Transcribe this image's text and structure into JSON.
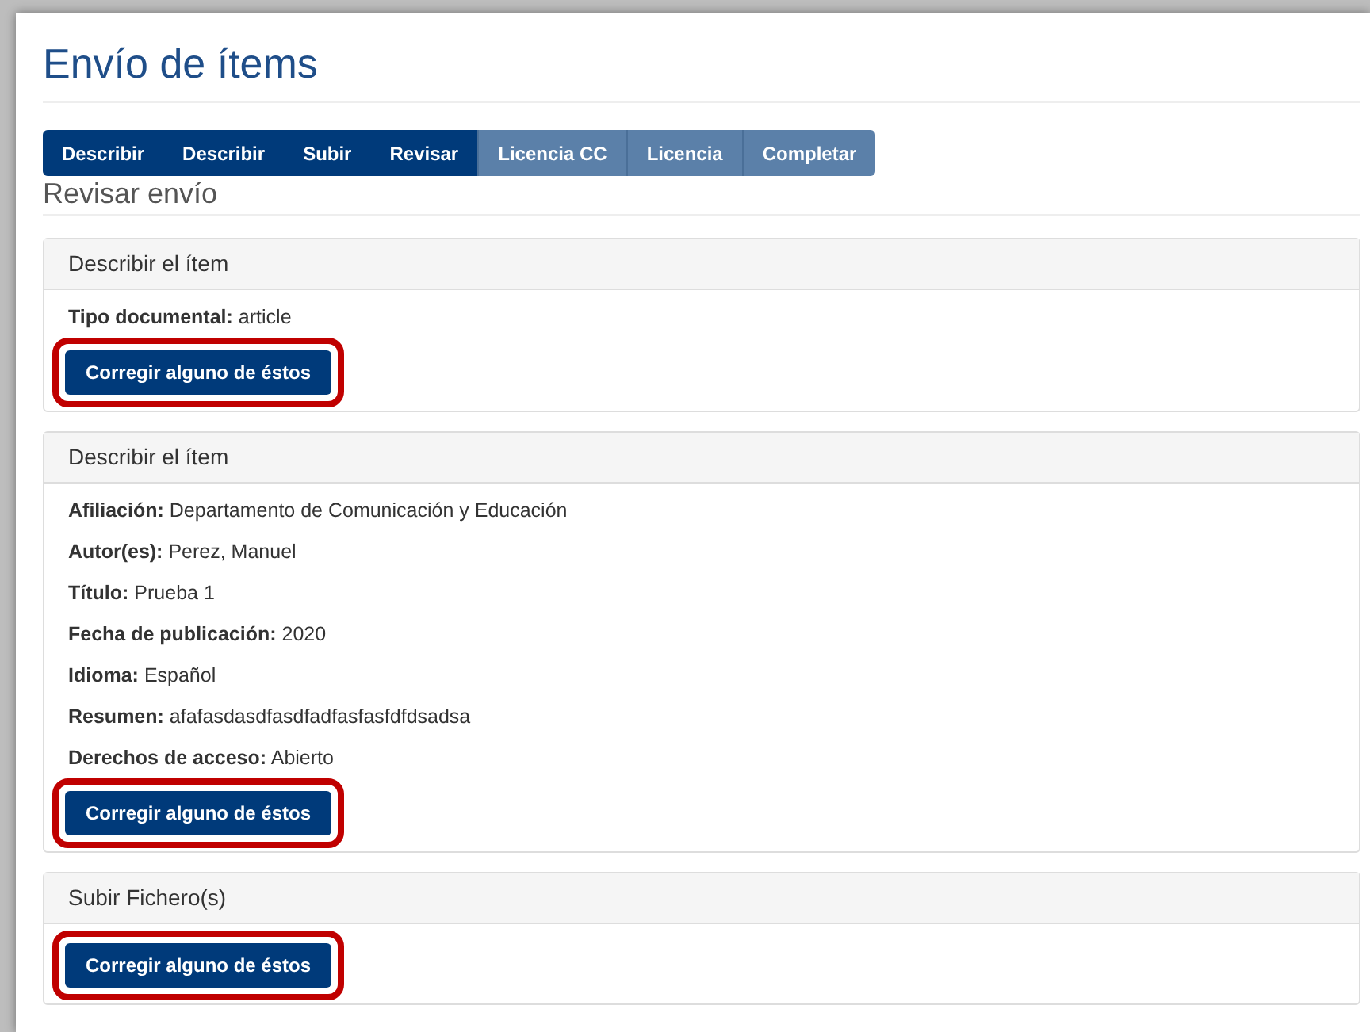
{
  "title": "Envío de ítems",
  "steps": [
    {
      "label": "Describir",
      "reached": true
    },
    {
      "label": "Describir",
      "reached": true
    },
    {
      "label": "Subir",
      "reached": true
    },
    {
      "label": "Revisar",
      "reached": true
    },
    {
      "label": "Licencia CC",
      "reached": false
    },
    {
      "label": "Licencia",
      "reached": false
    },
    {
      "label": "Completar",
      "reached": false
    }
  ],
  "subtitle": "Revisar envío",
  "sections": [
    {
      "heading": "Describir el ítem",
      "fields": [
        {
          "label": "Tipo documental:",
          "value": "article"
        }
      ],
      "button": "Corregir alguno de éstos",
      "highlighted": true
    },
    {
      "heading": "Describir el ítem",
      "fields": [
        {
          "label": "Afiliación:",
          "value": "Departamento de Comunicación y Educación"
        },
        {
          "label": "Autor(es):",
          "value": "Perez, Manuel"
        },
        {
          "label": "Título:",
          "value": "Prueba 1"
        },
        {
          "label": "Fecha de publicación:",
          "value": "2020"
        },
        {
          "label": "Idioma:",
          "value": "Español"
        },
        {
          "label": "Resumen:",
          "value": "afafasdasdfasdfadfasfasfdfdsadsa"
        },
        {
          "label": "Derechos de acceso:",
          "value": "Abierto"
        }
      ],
      "button": "Corregir alguno de éstos",
      "highlighted": true
    },
    {
      "heading": "Subir Fichero(s)",
      "button": "Corregir alguno de éstos",
      "highlighted": true
    }
  ]
}
